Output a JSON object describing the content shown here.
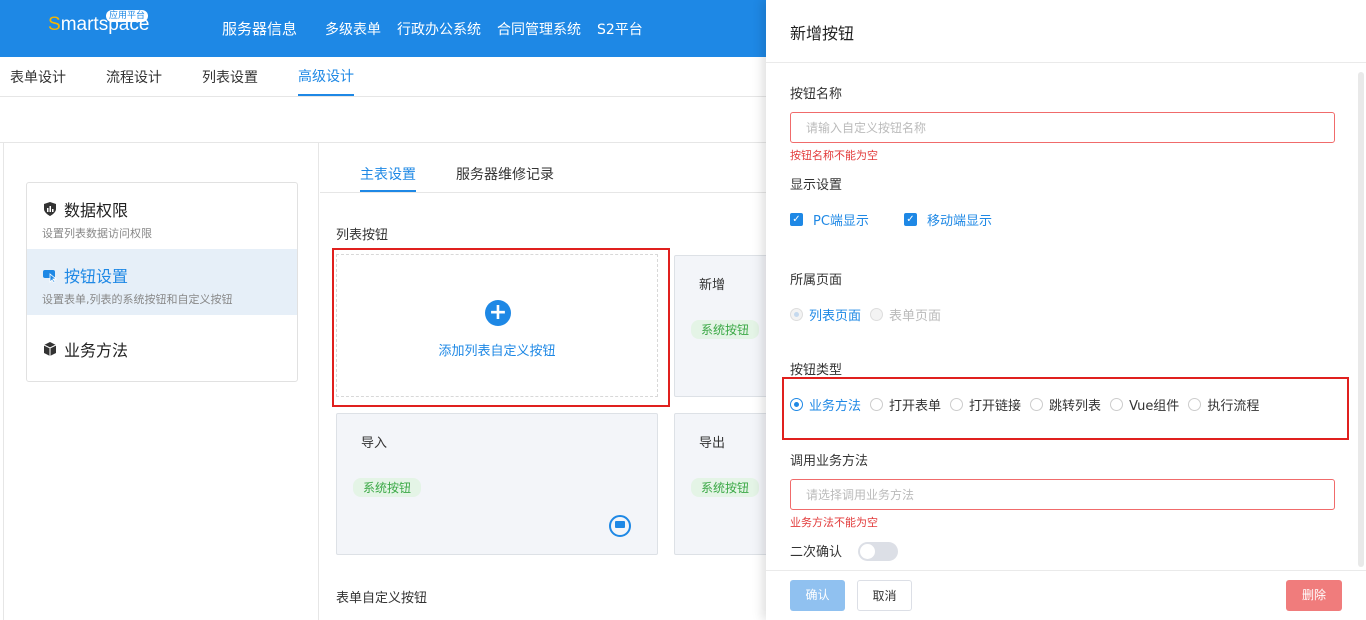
{
  "header": {
    "logo_text": "Smartspace",
    "logo_badge": "应用平台",
    "nav": [
      "服务器信息",
      "多级表单",
      "行政办公系统",
      "合同管理系统",
      "S2平台"
    ]
  },
  "subtabs": [
    "表单设计",
    "流程设计",
    "列表设置",
    "高级设计"
  ],
  "sidemenu": [
    {
      "title": "数据权限",
      "desc": "设置列表数据访问权限"
    },
    {
      "title": "按钮设置",
      "desc": "设置表单,列表的系统按钮和自定义按钮"
    },
    {
      "title": "业务方法",
      "desc": ""
    }
  ],
  "inner_tabs": [
    "主表设置",
    "服务器维修记录"
  ],
  "main": {
    "list_buttons_label": "列表按钮",
    "add_custom_label": "添加列表自定义按钮",
    "cards": [
      {
        "name": "新增",
        "tag": "系统按钮"
      },
      {
        "name": "导入",
        "tag": "系统按钮"
      },
      {
        "name": "导出",
        "tag": "系统按钮"
      }
    ],
    "form_custom_label": "表单自定义按钮"
  },
  "drawer": {
    "title": "新增按钮",
    "name_label": "按钮名称",
    "name_placeholder": "请输入自定义按钮名称",
    "name_error": "按钮名称不能为空",
    "display_label": "显示设置",
    "display_options": [
      "PC端显示",
      "移动端显示"
    ],
    "page_label": "所属页面",
    "page_options": [
      "列表页面",
      "表单页面"
    ],
    "type_label": "按钮类型",
    "type_options": [
      "业务方法",
      "打开表单",
      "打开链接",
      "跳转列表",
      "Vue组件",
      "执行流程"
    ],
    "method_label": "调用业务方法",
    "method_placeholder": "请选择调用业务方法",
    "method_error": "业务方法不能为空",
    "confirm_label": "二次确认",
    "ok": "确认",
    "cancel": "取消",
    "delete": "删除"
  },
  "colors": {
    "primary": "#1e88e5",
    "error": "#e23b3b",
    "highlight": "#e0201e"
  }
}
